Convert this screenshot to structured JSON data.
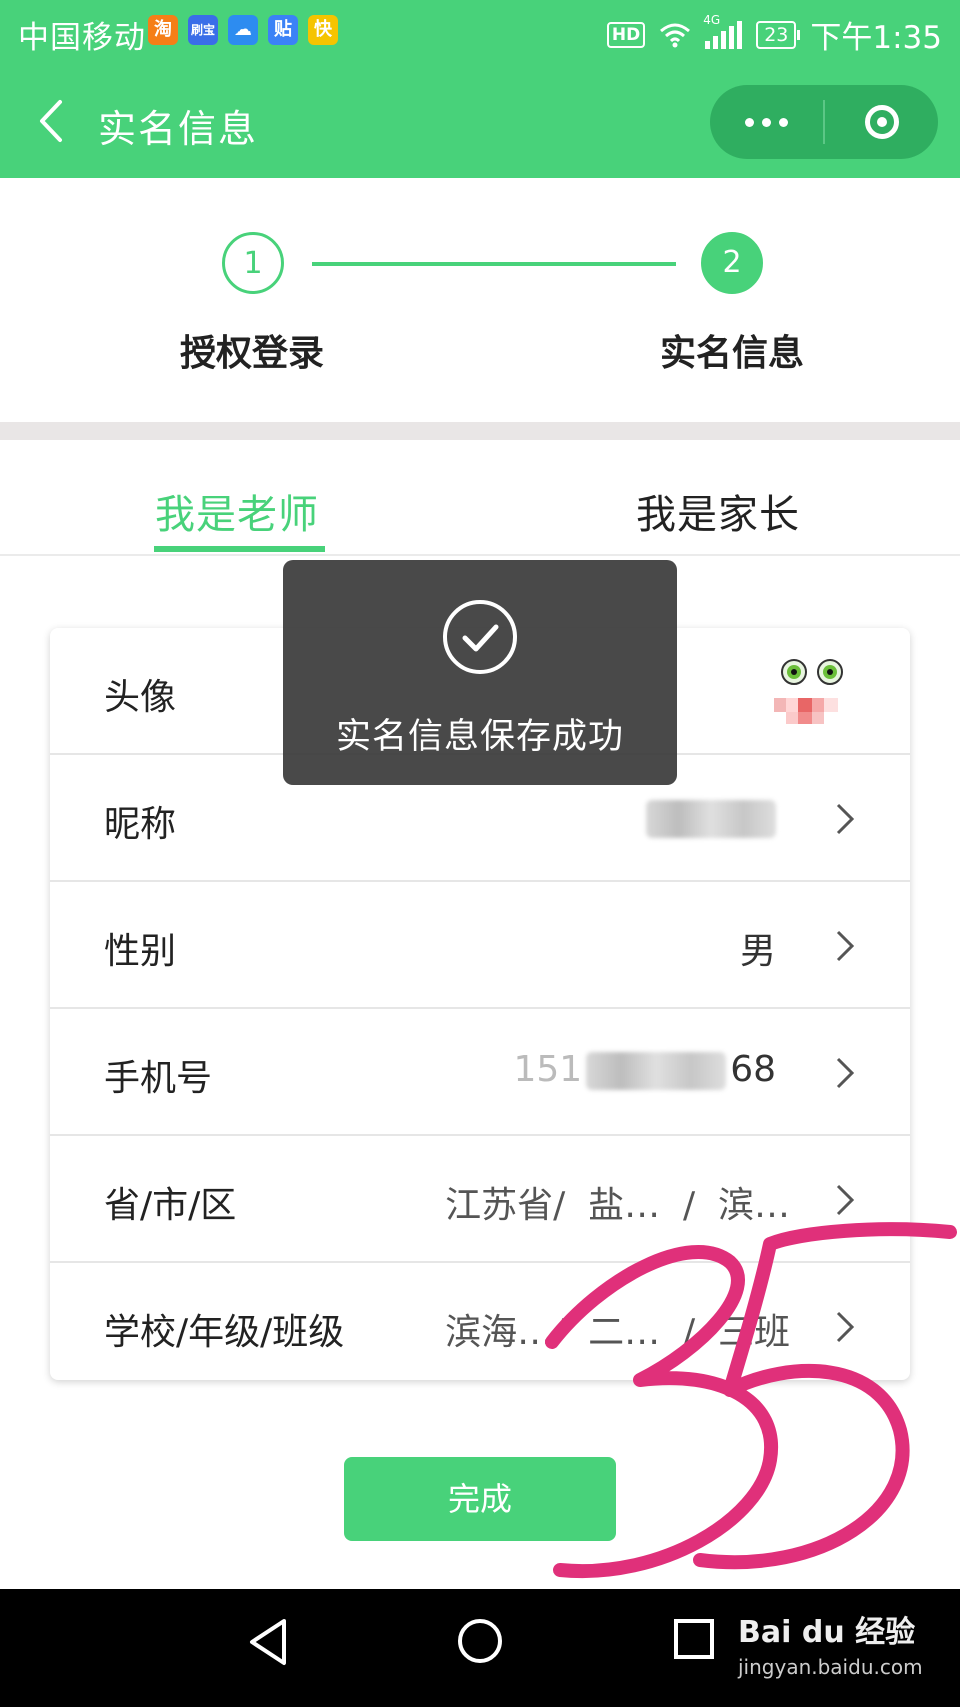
{
  "status_bar": {
    "carrier": "中国移动",
    "app_icons": [
      {
        "glyph": "淘",
        "color": "#f57f17"
      },
      {
        "glyph": "刷宝",
        "color": "#3a6ee8"
      },
      {
        "glyph": "☁",
        "color": "#2d8cf0"
      },
      {
        "glyph": "贴",
        "color": "#3b82f6"
      },
      {
        "glyph": "快",
        "color": "#f5c400"
      }
    ],
    "hd": "HD",
    "network": "4G",
    "battery": "23",
    "time": "下午1:35"
  },
  "nav": {
    "title": "实名信息"
  },
  "steps": [
    {
      "number": "1",
      "label": "授权登录"
    },
    {
      "number": "2",
      "label": "实名信息"
    }
  ],
  "tabs": {
    "teacher": "我是老师",
    "parent": "我是家长",
    "active": "teacher"
  },
  "form": {
    "avatar_label": "头像",
    "nickname_label": "昵称",
    "gender_label": "性别",
    "gender_value": "男",
    "phone_label": "手机号",
    "phone_prefix": "151",
    "phone_suffix": "68",
    "region_label": "省/市/区",
    "region_value": "江苏省/  盐…  /  滨…",
    "school_label": "学校/年级/班级",
    "school_value": "滨海…/  二…  /  三班"
  },
  "toast": {
    "message": "实名信息保存成功"
  },
  "done_button": "完成",
  "watermark": {
    "brand": "Bai du 经验",
    "url": "jingyan.baidu.com"
  },
  "handwriting": "35",
  "colors": {
    "brand_green": "#48d27a",
    "capsule_green": "#2fae60",
    "scribble_pink": "#e0307a"
  }
}
